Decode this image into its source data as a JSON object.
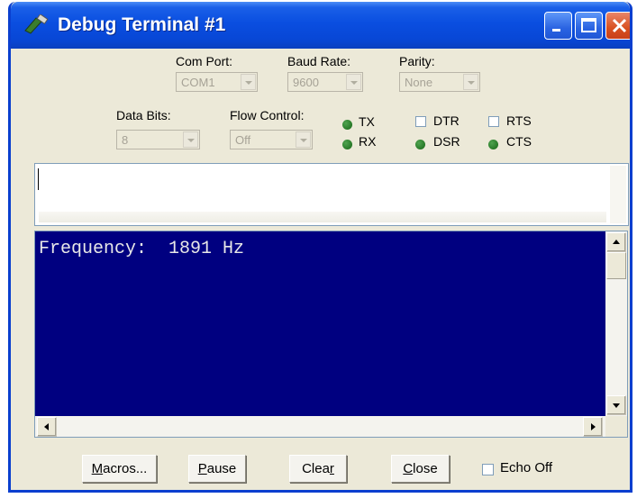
{
  "window": {
    "title": "Debug Terminal #1"
  },
  "titlebar_buttons": {
    "minimize_icon": "minimize-icon",
    "maximize_icon": "maximize-icon",
    "close_icon": "close-icon"
  },
  "settings": {
    "com_port": {
      "label": "Com Port:",
      "value": "COM1"
    },
    "baud_rate": {
      "label": "Baud Rate:",
      "value": "9600"
    },
    "parity": {
      "label": "Parity:",
      "value": "None"
    },
    "data_bits": {
      "label": "Data Bits:",
      "value": "8"
    },
    "flow_control": {
      "label": "Flow Control:",
      "value": "Off"
    }
  },
  "indicators": {
    "tx": "TX",
    "rx": "RX",
    "dsr": "DSR",
    "cts": "CTS",
    "dtr": "DTR",
    "rts": "RTS",
    "led_color": "#2e8b2e"
  },
  "output": {
    "line1": "Frequency:  1891 Hz",
    "background": "#000080"
  },
  "buttons": {
    "macros_pre": "",
    "macros_u": "M",
    "macros_post": "acros...",
    "pause_u": "P",
    "pause_post": "ause",
    "clear_pre": "Clea",
    "clear_u": "r",
    "close_u": "C",
    "close_post": "lose",
    "echo_off": "Echo Off"
  }
}
